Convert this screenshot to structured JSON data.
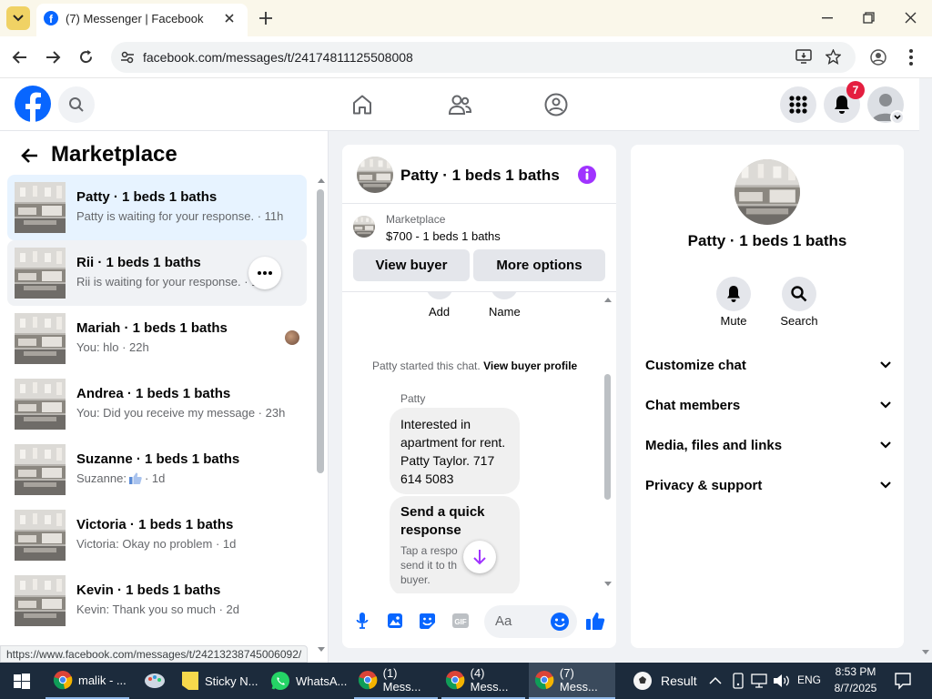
{
  "browser": {
    "tab_title": "(7) Messenger | Facebook",
    "url": "facebook.com/messages/t/24174811125508008",
    "status_url": "https://www.facebook.com/messages/t/24213238745006092/"
  },
  "fb_nav": {
    "notification_count": "7"
  },
  "left_panel": {
    "title": "Marketplace",
    "conversations": [
      {
        "name": "Patty · 1 beds 1 baths",
        "preview": "Patty is waiting for your response. · 11h"
      },
      {
        "name": "Rii · 1 beds 1 baths",
        "preview": "Rii is waiting for your response. · 1"
      },
      {
        "name": "Mariah · 1 beds 1 baths",
        "preview": "You: hlo · 22h"
      },
      {
        "name": "Andrea · 1 beds 1 baths",
        "preview": "You: Did you receive my message · 23h"
      },
      {
        "name": "Suzanne · 1 beds 1 baths",
        "preview_prefix": "Suzanne:",
        "preview_suffix": "· 1d"
      },
      {
        "name": "Victoria · 1 beds 1 baths",
        "preview": "Victoria: Okay no problem · 1d"
      },
      {
        "name": "Kevin · 1 beds 1 baths",
        "preview": "Kevin: Thank you so much · 2d"
      }
    ]
  },
  "chat": {
    "title": "Patty · 1 beds 1 baths",
    "listing_label": "Marketplace",
    "listing_detail": "$700 - 1 beds 1 baths",
    "view_buyer": "View buyer",
    "more_options": "More options",
    "action_add": "Add",
    "action_name": "Name",
    "started_text": "Patty started this chat.",
    "view_profile": "View buyer profile",
    "sender_name": "Patty",
    "message_text": "Interested in apartment for rent.  Patty Taylor. 717 614 5083",
    "quick_title": "Send a quick response",
    "quick_sub": "Tap a respo send it to th buyer.",
    "composer_placeholder": "Aa"
  },
  "details": {
    "title": "Patty · 1 beds 1 baths",
    "mute": "Mute",
    "search": "Search",
    "sections": [
      "Customize chat",
      "Chat members",
      "Media, files and links",
      "Privacy & support"
    ]
  },
  "taskbar": {
    "items": [
      "malik - ...",
      "Sticky N...",
      "WhatsA...",
      "(1) Mess...",
      "(4) Mess...",
      "(7) Mess..."
    ],
    "weather": "Result",
    "lang": "ENG",
    "time": "8:53 PM",
    "date": "8/7/2025"
  },
  "colors": {
    "fb_blue": "#0866ff",
    "accent_purple": "#a033ff",
    "badge_red": "#e41e3f",
    "selected_row": "#e7f3ff"
  }
}
